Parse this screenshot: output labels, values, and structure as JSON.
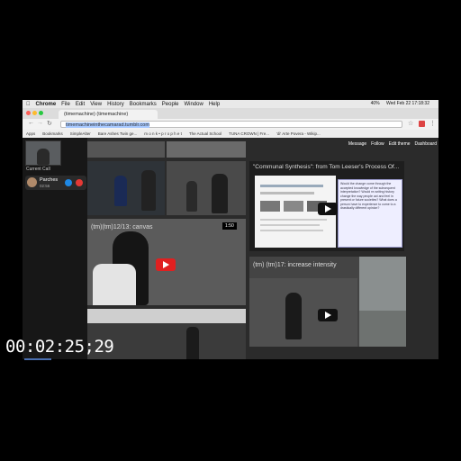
{
  "menubar": {
    "app": "Chrome",
    "items": [
      "File",
      "Edit",
      "View",
      "History",
      "Bookmarks",
      "People",
      "Window",
      "Help"
    ],
    "battery": "40%",
    "clock": "Wed Feb 22  17:18:32"
  },
  "tab": {
    "title": "(timemachine) (timemachine)"
  },
  "address": {
    "url": "timemachineinthecamarad.tumblr.com"
  },
  "bookmarks": [
    "Apps",
    "Bookmarks",
    "SimpleAlter",
    "Bare Ashes Twin ge...",
    "m o n k • p r o p h e t",
    "The Actual School",
    "TUNA CROWN | Fre...",
    "'di' Arte Povera - Wikip..."
  ],
  "tumblr_bar": {
    "message": "Message",
    "follow": "Follow",
    "edit_theme": "Edit theme",
    "dashboard": "Dashboard"
  },
  "call": {
    "label": "Current Call",
    "caller_name": "Parches",
    "caller_time": "02:56"
  },
  "posts": {
    "p1_title": "(tm)(tm)12/13: canvas",
    "p1_duration": "1:50",
    "p2_title": "\"Communal Synthesis\": from Tom Leeser's Process Of...",
    "p3_title": "(tm) (tm)17: increase intensity"
  },
  "doc_side_text": "Would the change come through the accepted knowledge of the subsequent interpretation? Would re-writing history change the way people act and feel in present or future societies? What does a person have to experience to come to a drastically different opinion?",
  "timecode": "00:02:25;29"
}
